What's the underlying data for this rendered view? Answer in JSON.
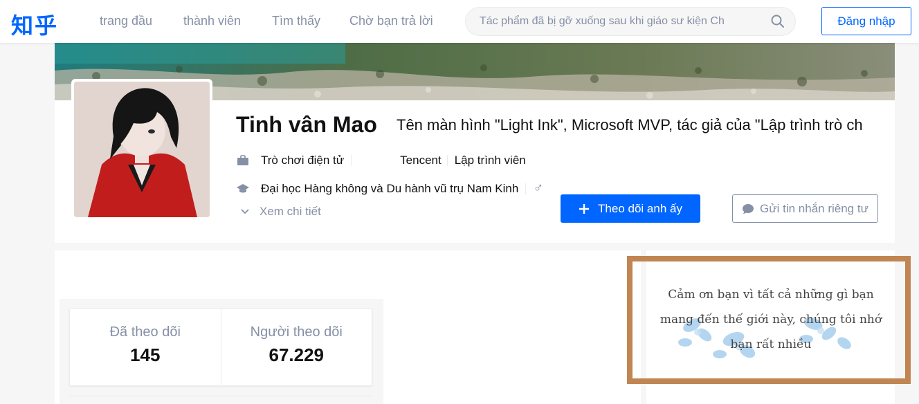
{
  "header": {
    "logo": "知乎",
    "nav": [
      "trang đầu",
      "thành viên",
      "Tìm thấy",
      "Chờ bạn trả lời"
    ],
    "search_placeholder": "Tác phẩm đã bị gỡ xuống sau khi giáo sư kiện Ch",
    "login_label": "Đăng nhập"
  },
  "profile": {
    "name": "Tinh vân Mao",
    "headline": "Tên màn hình \"Light Ink\", Microsoft MVP, tác giả của \"Lập trình trò ch",
    "job_industry": "Trò chơi điện tử",
    "company": "Tencent",
    "position": "Lập trình viên",
    "school": "Đại học Hàng không và Du hành vũ trụ Nam Kinh",
    "gender_symbol": "♂",
    "detail_label": "Xem chi tiết",
    "follow_label": "Theo dõi anh ấy",
    "message_label": "Gửi tin nhắn riêng tư"
  },
  "stats": {
    "following_label": "Đã theo dõi",
    "following_value": "145",
    "followers_label": "Người theo dõi",
    "followers_value": "67.229"
  },
  "tribute": {
    "text": "Cảm ơn bạn vì tất cả những gì bạn mang đến thế giới này, chúng tôi nhớ bạn rất nhiều"
  },
  "colors": {
    "brand": "#0066ff",
    "muted": "#8590a6",
    "frame": "#c08552"
  },
  "icons": {
    "search": "search-icon",
    "briefcase": "briefcase-icon",
    "graduation": "graduation-cap-icon",
    "chevron": "chevron-down-icon",
    "plus": "plus-icon",
    "chat": "chat-bubble-icon"
  }
}
